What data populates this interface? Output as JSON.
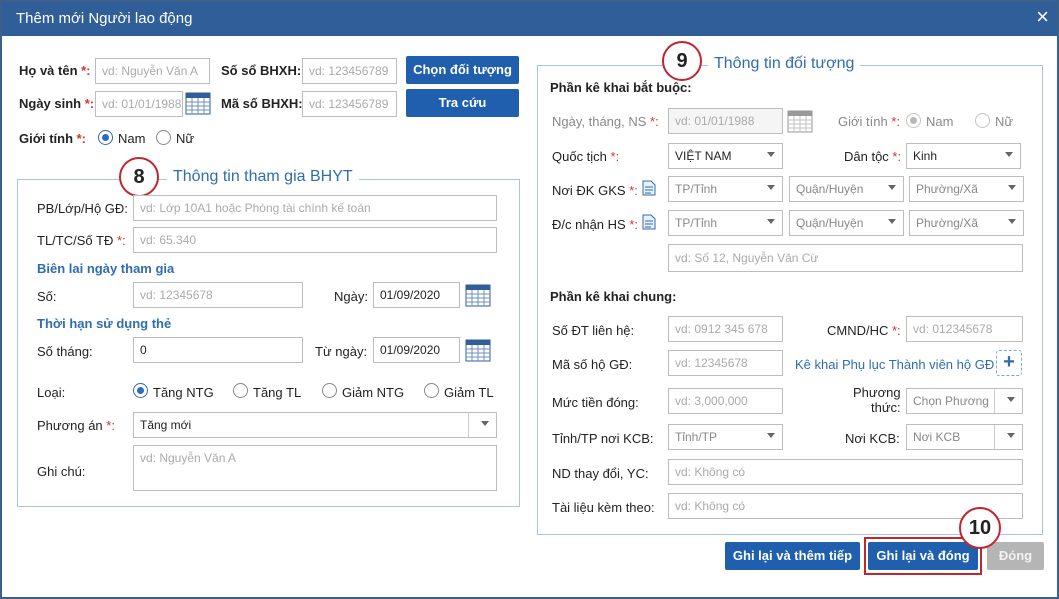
{
  "title": "Thêm mới Người lao động",
  "close_glyph": "×",
  "top": {
    "ho_ten_label": "Họ và tên ",
    "ho_ten_ph": "vd: Nguyễn Văn A",
    "so_so_label": "Số sổ BHXH:",
    "so_so_ph": "vd: 123456789",
    "chon_btn": "Chọn đối tượng",
    "ngay_sinh_label": "Ngày sinh ",
    "ngay_sinh_ph": "vd: 01/01/1988",
    "ma_so_label": "Mã số BHXH:",
    "ma_so_ph": "vd: 123456789",
    "tra_cuu_btn": "Tra cứu",
    "gioi_tinh_label": "Giới tính ",
    "nam": "Nam",
    "nu": "Nữ",
    "star_colon": "*:"
  },
  "left": {
    "badge": "8",
    "legend": "Thông tin tham gia BHYT",
    "pb_label": "PB/Lớp/Hộ GĐ:",
    "pb_ph": "vd: Lớp 10A1 hoặc Phòng tài chính kế toán",
    "tl_label": "TL/TC/Số TĐ ",
    "tl_ph": "vd: 65.340",
    "bien_lai": "Biên lai ngày tham gia",
    "so_label": "Số:",
    "so_ph": "vd: 12345678",
    "ngay_label": "Ngày:",
    "ngay_val": "01/09/2020",
    "thoi_han": "Thời hạn sử dụng thẻ",
    "so_thang_label": "Số tháng:",
    "so_thang_val": "0",
    "tu_ngay_label": "Từ ngày:",
    "tu_ngay_val": "01/09/2020",
    "loai_label": "Loại:",
    "loai_opts": [
      "Tăng NTG",
      "Tăng TL",
      "Giảm NTG",
      "Giảm TL"
    ],
    "phuong_an_label": "Phương án ",
    "phuong_an_val": "Tăng mới",
    "ghi_chu_label": "Ghi chú:",
    "ghi_chu_ph": "vd: Nguyễn Văn A"
  },
  "right": {
    "badge": "9",
    "legend": "Thông tin đối tượng",
    "bat_buoc": "Phần kê khai bắt buộc:",
    "ngay_ns_label": "Ngày, tháng, NS ",
    "ngay_ns_ph": "vd: 01/01/1988",
    "gioi_tinh_label": "Giới tính ",
    "nam": "Nam",
    "nu": "Nữ",
    "quoc_tich_label": "Quốc tịch ",
    "quoc_tich_val": "VIỆT NAM",
    "dan_toc_label": "Dân tộc ",
    "dan_toc_val": "Kinh",
    "noi_dk_label": "Nơi ĐK GKS ",
    "dc_nhan_label": "Đ/c nhận HS ",
    "tp_ph": "TP/Tỉnh",
    "quan_ph": "Quận/Huyện",
    "phuong_ph": "Phường/Xã",
    "dia_chi_ph": "vd: Số 12, Nguyễn Văn Cừ",
    "chung": "Phần kê khai chung:",
    "sdt_label": "Số ĐT liên hệ:",
    "sdt_ph": "vd: 0912 345 678",
    "cmnd_label": "CMND/HC ",
    "cmnd_ph": "vd: 012345678",
    "ma_ho_label": "Mã số hộ GĐ:",
    "ma_ho_ph": "vd: 12345678",
    "ke_khai_link": "Kê khai Phụ lục Thành viên hộ GĐ",
    "muc_tien_label": "Mức tiền đóng:",
    "muc_tien_ph": "vd: 3,000,000",
    "phuong_thuc_label1": "Phương",
    "phuong_thuc_label2": "thức:",
    "phuong_thuc_ph": "Chọn Phương",
    "tinh_kcb_label": "Tỉnh/TP nơi KCB:",
    "tinh_kcb_ph": "Tỉnh/TP",
    "noi_kcb_label": "Nơi KCB:",
    "noi_kcb_ph": "Nơi KCB",
    "nd_label": "ND thay đổi, YC:",
    "nd_ph": "vd: Không có",
    "tai_lieu_label": "Tài liệu kèm theo:",
    "tai_lieu_ph": "vd: Không có",
    "star_colon": "*:"
  },
  "footer": {
    "badge": "10",
    "save_next": "Ghi lại và thêm tiếp",
    "save_close": "Ghi lại và đóng",
    "close": "Đóng"
  },
  "colors": {
    "titlebar": "#2f5e99",
    "button": "#1f5fae",
    "legend": "#2f6cb1",
    "required": "#d9302a",
    "highlight": "#c0262d"
  }
}
